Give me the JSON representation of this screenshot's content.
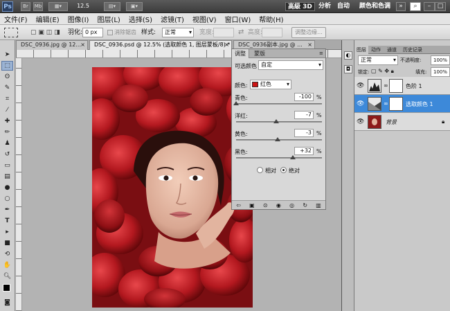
{
  "titlebar": {
    "app_logo": "Ps",
    "br": "Br",
    "mb": "Mb",
    "zoom": "12.5",
    "workspaces": [
      "高級 3D",
      "分析",
      "自动",
      "颜色和色调"
    ],
    "search_icon": "search-icon",
    "window_min": "–",
    "window_max": "□",
    "window_close": "×"
  },
  "menubar": [
    "文件(F)",
    "编辑(E)",
    "图像(I)",
    "图层(L)",
    "选择(S)",
    "滤镜(T)",
    "视图(V)",
    "窗口(W)",
    "帮助(H)"
  ],
  "options": {
    "feather_label": "羽化:",
    "feather_value": "0 px",
    "antialias_label": "消除锯齿",
    "style_label": "样式:",
    "style_value": "正常",
    "width_label": "宽度:",
    "height_label": "高度:",
    "refine_edge": "调整边缘..."
  },
  "tabs": [
    {
      "label": "DSC_0936.jpg @ 12...",
      "active": false
    },
    {
      "label": "DSC_0936.psd @ 12.5% (选取颜色 1, 图层蒙板/8) *",
      "active": true
    },
    {
      "label": "DSC_0936副本.jpg @ ...",
      "active": false
    }
  ],
  "adjustments": {
    "tabs": [
      "调整",
      "蒙版"
    ],
    "title": "可选颜色",
    "preset": "自定",
    "color_label": "颜色:",
    "color_value": "红色",
    "swatch": "#cc1414",
    "sliders": [
      {
        "label": "青色:",
        "value": "-100",
        "level": 0
      },
      {
        "label": "洋红:",
        "value": "-7",
        "level": 0.465
      },
      {
        "label": "黄色:",
        "value": "-3",
        "level": 0.485
      },
      {
        "label": "黑色:",
        "value": "+32",
        "level": 0.66
      }
    ],
    "unit": "%",
    "method_relative": "相对",
    "method_absolute": "绝对"
  },
  "layers": {
    "tabs": [
      "图层",
      "动作",
      "通道",
      "历史记录"
    ],
    "blend": "正常",
    "opacity_label": "不透明度:",
    "opacity": "100%",
    "lock_label": "锁定:",
    "fill_label": "填充:",
    "fill": "100%",
    "items": [
      {
        "name": "色阶 1",
        "selected": false
      },
      {
        "name": "选取颜色 1",
        "selected": true
      },
      {
        "name": "背景",
        "selected": false
      }
    ]
  }
}
